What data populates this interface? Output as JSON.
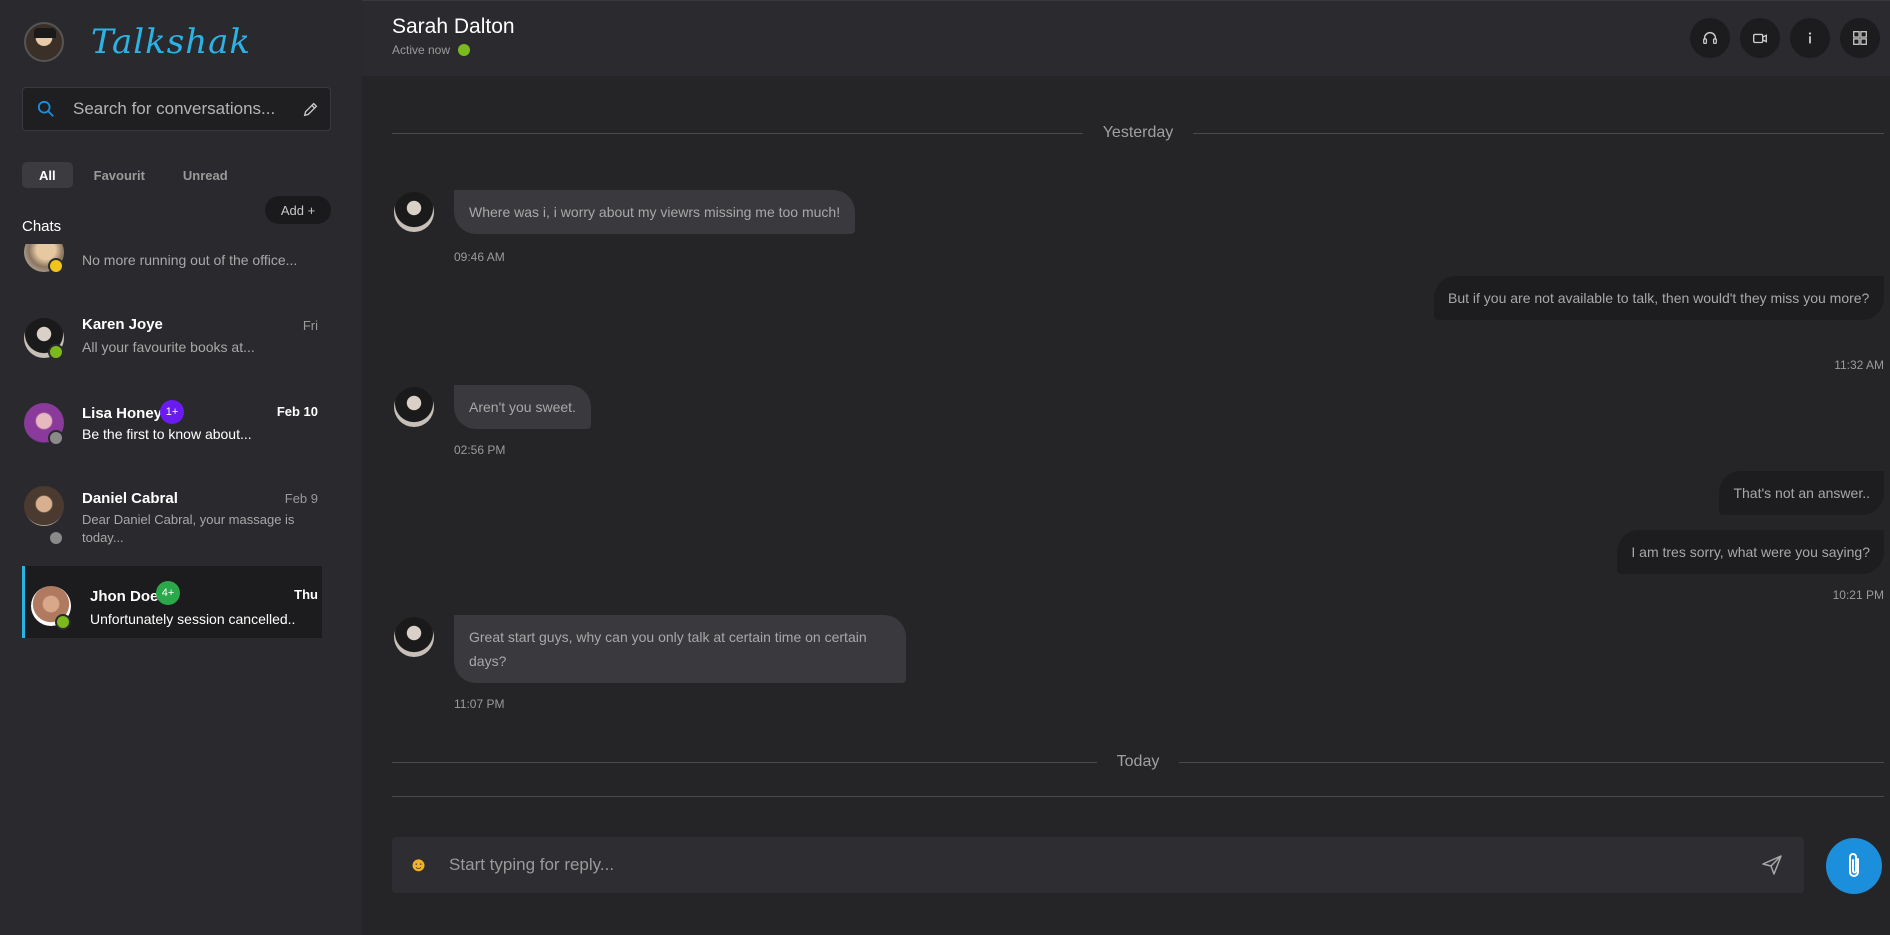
{
  "app": {
    "brand": "Talkshak"
  },
  "search": {
    "placeholder": "Search for conversations..."
  },
  "filters": [
    {
      "label": "All",
      "active": true
    },
    {
      "label": "Favourit",
      "active": false
    },
    {
      "label": "Unread",
      "active": false
    }
  ],
  "sidebar": {
    "add_label": "Add +",
    "chats_title": "Chats",
    "chats": [
      {
        "name": "",
        "message": "No more running out of the office...",
        "date": "",
        "status": "away",
        "badge": ""
      },
      {
        "name": "Karen Joye",
        "message": "All your favourite books at...",
        "date": "Fri",
        "status": "online",
        "badge": ""
      },
      {
        "name": "Lisa Honey",
        "message": "Be the first to know about...",
        "date": "Feb 10",
        "status": "offline",
        "badge": "1+"
      },
      {
        "name": "Daniel Cabral",
        "message": "Dear Daniel Cabral, your massage is today...",
        "date": "Feb 9",
        "status": "offline",
        "badge": ""
      },
      {
        "name": "Jhon Doe",
        "message": "Unfortunately session cancelled..",
        "date": "Thu",
        "status": "online",
        "badge": "4+"
      }
    ]
  },
  "header": {
    "contact_name": "Sarah Dalton",
    "status_text": "Active now",
    "status_color": "#7bb91c"
  },
  "conversation": {
    "dividers": [
      "Yesterday",
      "Today"
    ],
    "messages": [
      {
        "direction": "in",
        "text": "Where was i, i worry about my viewrs missing me too much!",
        "time": "09:46 AM"
      },
      {
        "direction": "out",
        "text": "But if you are not available to talk, then would't they miss you more?",
        "time": "11:32 AM"
      },
      {
        "direction": "in",
        "text": "Aren't you sweet.",
        "time": "02:56 PM"
      },
      {
        "direction": "out",
        "text": "That's not an answer..",
        "time": ""
      },
      {
        "direction": "out",
        "text": "I am tres sorry, what were you saying?",
        "time": "10:21 PM"
      },
      {
        "direction": "in",
        "text": "Great start guys, why can you only talk at certain time on certain days?",
        "time": "11:07 PM"
      }
    ]
  },
  "composer": {
    "placeholder": "Start typing for reply..."
  },
  "colors": {
    "accent": "#2ab4e6",
    "attach": "#1b8fdc",
    "online": "#7bb91c",
    "away": "#f0c419",
    "offline": "#8a8a8a",
    "badge_purple": "#6a1cf0",
    "badge_green": "#2aa84a"
  },
  "icons": [
    "search-icon",
    "pencil-icon",
    "headset-icon",
    "video-icon",
    "info-icon",
    "grid-icon",
    "emoji-icon",
    "send-icon",
    "paperclip-icon"
  ]
}
